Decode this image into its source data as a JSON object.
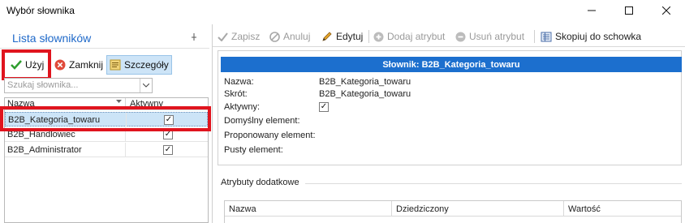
{
  "window": {
    "title": "Wybór słownika",
    "minimize": "—",
    "maximize": "☐",
    "close": "✕"
  },
  "left_panel": {
    "title": "Lista słowników",
    "pin": "⊥",
    "toolbar": {
      "use_label": "Użyj",
      "close_label": "Zamknij",
      "details_label": "Szczegóły"
    },
    "search": {
      "placeholder": "Szukaj słownika..."
    },
    "grid": {
      "columns": [
        "Nazwa",
        "Aktywny"
      ],
      "rows": [
        {
          "name": "B2B_Kategoria_towaru",
          "active": true,
          "selected": true
        },
        {
          "name": "B2B_Handlowiec",
          "active": true,
          "selected": false
        },
        {
          "name": "B2B_Administrator",
          "active": true,
          "selected": false
        }
      ]
    }
  },
  "right_panel": {
    "toolbar": {
      "save_label": "Zapisz",
      "cancel_label": "Anuluj",
      "edit_label": "Edytuj",
      "add_attr_label": "Dodaj atrybut",
      "remove_attr_label": "Usuń atrybut",
      "copy_label": "Skopiuj do schowka"
    },
    "banner": "Słownik: B2B_Kategoria_towaru",
    "fields": {
      "name_label": "Nazwa:",
      "name_value": "B2B_Kategoria_towaru",
      "short_label": "Skrót:",
      "short_value": "B2B_Kategoria_towaru",
      "active_label": "Aktywny:",
      "default_label": "Domyślny element:",
      "proposed_label": "Proponowany element:",
      "empty_label": "Pusty element:"
    },
    "attributes": {
      "section_label": "Atrybuty dodatkowe",
      "columns": [
        "Nazwa",
        "Dziedziczony",
        "Wartość"
      ]
    }
  },
  "colors": {
    "accent": "#1c6fce",
    "title_blue": "#1f69c9",
    "selection": "#cce4f7",
    "highlight_red": "#e0141e"
  }
}
